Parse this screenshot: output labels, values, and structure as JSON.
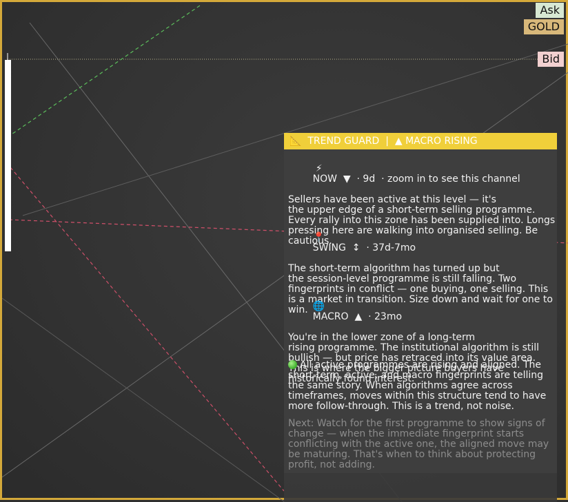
{
  "prices": {
    "ask_label": "Ask",
    "symbol_label": "GOLD",
    "bid_label": "Bid"
  },
  "colors": {
    "frame": "#d4a93a",
    "header_bg": "#f0cf3a",
    "ask_bg": "#d7e8d2",
    "bid_bg": "#f2d0d0",
    "symbol_bg": "#d8b87a",
    "resistance_line": "#d0506a",
    "support_line": "#5cbf5c"
  },
  "panel": {
    "header": "📐  TREND GUARD  |  ▲ MACRO RISING",
    "now": {
      "icon": "lightning-icon",
      "glyph": "⚡",
      "title": "NOW  ▼  · 9d  · zoom in to see this channel",
      "text": "Sellers have been active at this level — it's\nthe upper edge of a short-term selling programme. Every rally into this zone has been supplied into. Longs pressing here are walking into organised selling. Be cautious."
    },
    "swing": {
      "icon": "pushpin-icon",
      "glyph": "📍",
      "title": "SWING  ↕  · 37d-7mo",
      "text": "The short-term algorithm has turned up but\nthe session-level programme is still falling. Two fingerprints in conflict — one buying, one selling. This is a market in transition. Size down and wait for one to win."
    },
    "macro": {
      "icon": "globe-icon",
      "glyph": "🌐",
      "title": "MACRO  ▲  · 23mo",
      "text": "You're in the lower zone of a long-term\nrising programme. The institutional algorithm is still bullish — but price has retraced into its value area. This is where the bigger picture buyers have historically found interest."
    },
    "aligned": {
      "icon": "green-circle-icon",
      "text": "All active programmes are rising and aligned. The short-term, active, and macro fingerprints are telling the same story. When algorithms agree across timeframes, moves within this structure tend to have more follow-through. This is a trend, not noise."
    },
    "next": {
      "text": "Next: Watch for the first programme to show signs of change — when the immediate fingerprint starts conflicting with the active one, the aligned move may be maturing. That's when to think about protecting profit, not adding."
    }
  }
}
